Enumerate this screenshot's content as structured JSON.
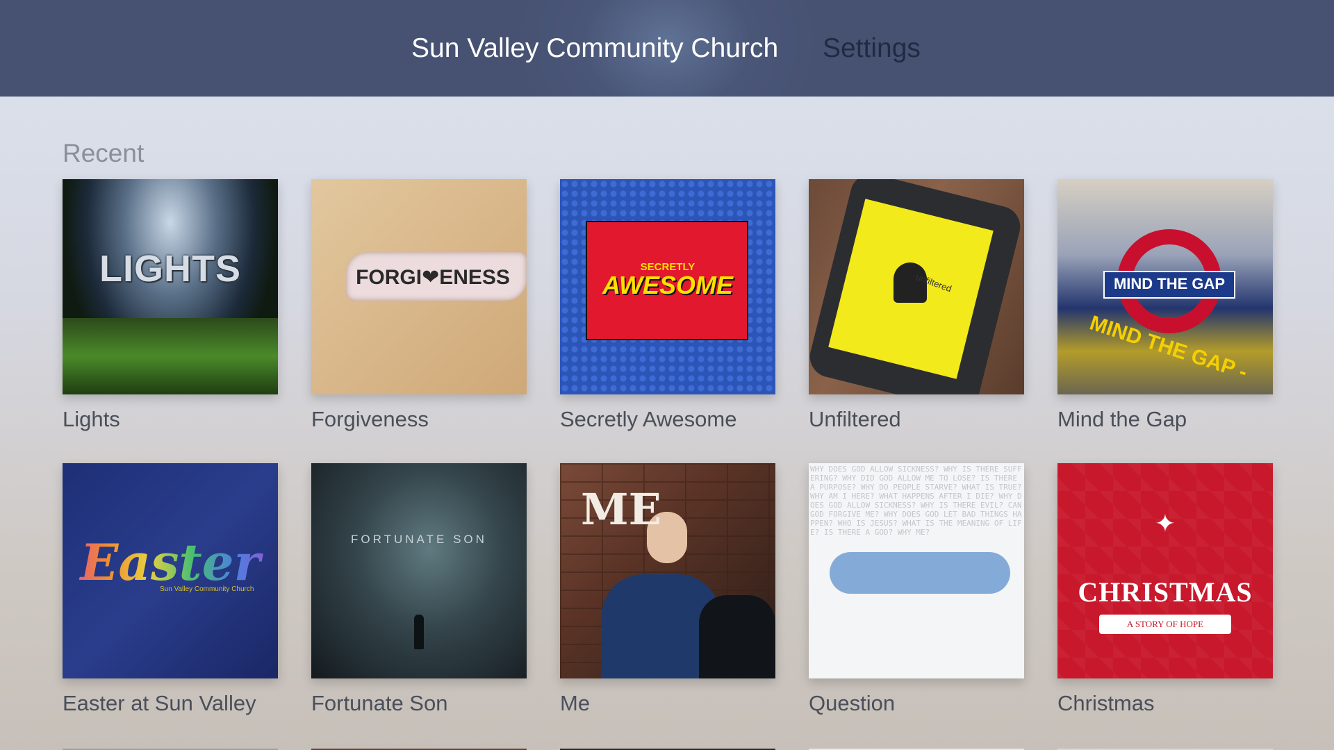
{
  "nav": {
    "tabs": [
      {
        "label": "Sun Valley Community Church",
        "selected": true
      },
      {
        "label": "Settings",
        "selected": false
      }
    ]
  },
  "recent": {
    "title": "Recent",
    "items": [
      {
        "caption": "Lights",
        "art_text": "LIGHTS"
      },
      {
        "caption": "Forgiveness",
        "art_text": "FORGI❤ENESS"
      },
      {
        "caption": "Secretly Awesome",
        "art_text": "AWESOME",
        "art_subtext": "SECRETLY"
      },
      {
        "caption": "Unfiltered",
        "art_text": "unfiltered"
      },
      {
        "caption": "Mind the Gap",
        "art_text": "MIND THE GAP",
        "art_subtext": "MIND THE GAP -"
      },
      {
        "caption": "Easter at Sun Valley",
        "art_text": "Easter",
        "art_subtext": "Sun Valley Community Church"
      },
      {
        "caption": "Fortunate Son",
        "art_text": "FORTUNATE SON"
      },
      {
        "caption": "Me",
        "art_text": "ME"
      },
      {
        "caption": "Question",
        "art_text": "WHY DOES GOD ALLOW SICKNESS? WHY IS THERE SUFFERING? WHY DID GOD ALLOW ME TO LOSE? IS THERE A PURPOSE? WHY DO PEOPLE STARVE? WHAT IS TRUE? WHY AM I HERE? WHAT HAPPENS AFTER I DIE? WHY DOES GOD ALLOW SICKNESS? WHY IS THERE EVIL? CAN GOD FORGIVE ME? WHY DOES GOD LET BAD THINGS HAPPEN? WHO IS JESUS? WHAT IS THE MEANING OF LIFE? IS THERE A GOD? WHY ME?"
      },
      {
        "caption": "Christmas",
        "art_text": "CHRISTMAS",
        "art_subtext": "A STORY OF HOPE"
      }
    ]
  },
  "colors": {
    "topbar": "#475273",
    "tab_selected": "#ffffff",
    "tab_unselected": "#1f2a44",
    "caption": "#4a4f59"
  }
}
